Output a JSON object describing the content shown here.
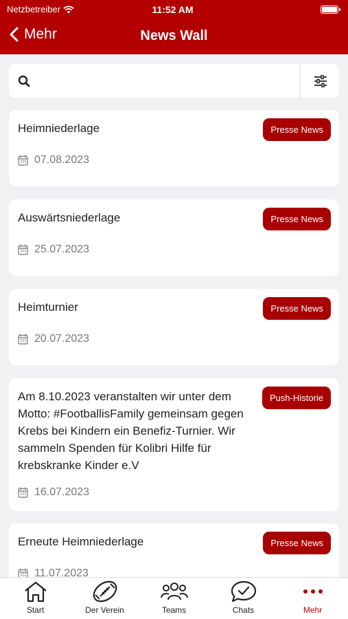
{
  "status_bar": {
    "carrier": "Netzbetreiber",
    "time": "11:52 AM"
  },
  "nav": {
    "back_label": "Mehr",
    "title": "News Wall"
  },
  "search": {
    "placeholder": ""
  },
  "feed": [
    {
      "title": "Heimniederlage",
      "badge": "Presse News",
      "date": "07.08.2023"
    },
    {
      "title": "Auswärtsniederlage",
      "badge": "Presse News",
      "date": "25.07.2023"
    },
    {
      "title": "Heimturnier",
      "badge": "Presse News",
      "date": "20.07.2023"
    },
    {
      "title": "Am 8.10.2023 veranstalten wir unter dem Motto: #FootballisFamily gemeinsam gegen Krebs bei Kindern ein Benefiz-Turnier. Wir sammeln Spenden für Kolibri Hilfe für krebskranke Kinder e.V",
      "badge": "Push-Historie",
      "date": "16.07.2023"
    },
    {
      "title": "Erneute Heimniederlage",
      "badge": "Presse News",
      "date": "11.07.2023"
    }
  ],
  "tabs": [
    {
      "label": "Start",
      "icon": "home-icon"
    },
    {
      "label": "Der Verein",
      "icon": "football-icon"
    },
    {
      "label": "Teams",
      "icon": "people-icon"
    },
    {
      "label": "Chats",
      "icon": "chat-icon"
    },
    {
      "label": "Mehr",
      "icon": "more-dots-icon"
    }
  ],
  "colors": {
    "brand": "#b30000",
    "badge": "#a80000"
  }
}
